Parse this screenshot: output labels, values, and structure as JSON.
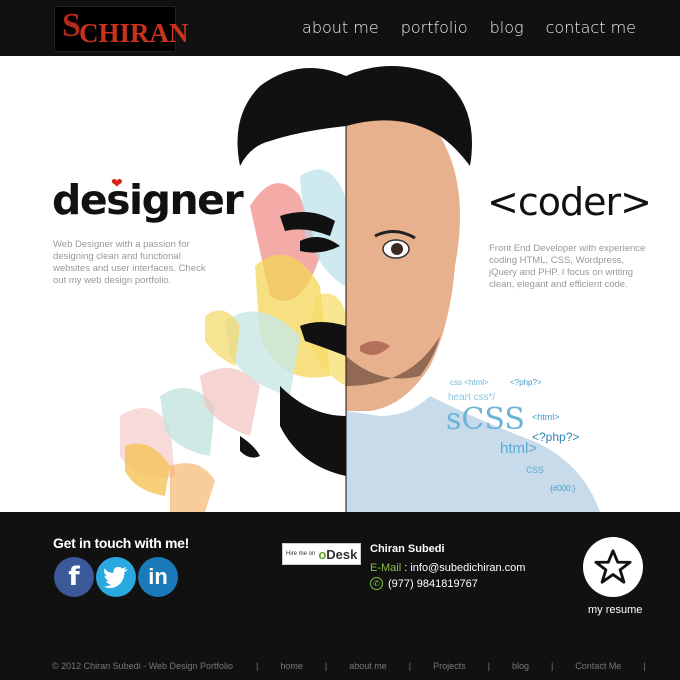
{
  "header": {
    "logo_s": "S",
    "logo_text": "CHIRAN",
    "nav": [
      "about me",
      "portfolio",
      "blog",
      "contact me"
    ]
  },
  "hero": {
    "designer_title": "designer",
    "designer_desc": "Web Designer with a passion for designing clean and functional websites and user interfaces. Check out my web design portfolio.",
    "coder_title": "<coder>",
    "coder_desc": "Front End Developer with experience coding HTML, CSS, Wordpress, jQuery and PHP. I focus on writing clean, elegant and efficient code.",
    "code_words": [
      "css <html>",
      "<?php?>",
      "heart css*/",
      "sCSS",
      "<html>",
      "<?php?>",
      "html>",
      "css",
      "{#000;}"
    ]
  },
  "contact": {
    "get_in_touch": "Get in touch with me!",
    "social": [
      "f",
      "in"
    ],
    "odesk_small": "Hire me on",
    "odesk_o": "o",
    "odesk_desk": "Desk",
    "name": "Chiran Subedi",
    "email_label": "E-Mail",
    "email_sep": " : ",
    "email": "info@subedichiran.com",
    "phone": "(977) 9841819767",
    "resume_label": "my resume"
  },
  "footer": {
    "copyright": "© 2012 Chiran Subedi - Web Design Portfolio",
    "links": [
      "home",
      "about me",
      "Projects",
      "blog",
      "Contact Me"
    ]
  },
  "colors": {
    "brand_red": "#c8321f",
    "accent_green": "#7cc142",
    "background": "#111111"
  },
  "icons": [
    "heart-icon",
    "facebook-icon",
    "twitter-icon",
    "linkedin-icon",
    "phone-icon",
    "star-icon"
  ]
}
